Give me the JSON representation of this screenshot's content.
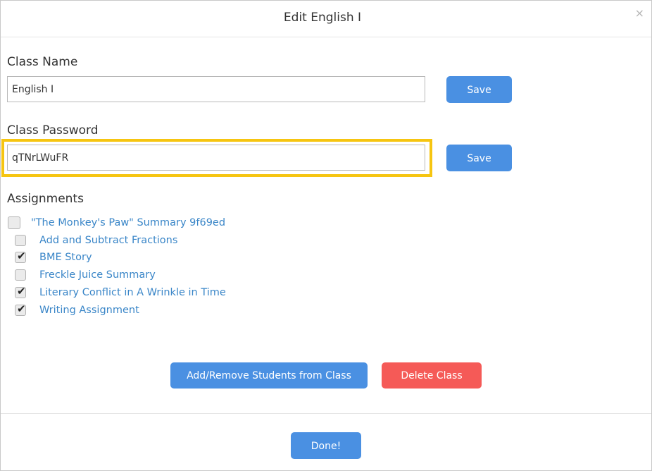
{
  "modal": {
    "title": "Edit English I",
    "close_glyph": "×"
  },
  "class_name": {
    "label": "Class Name",
    "value": "English I",
    "save_label": "Save"
  },
  "class_password": {
    "label": "Class Password",
    "value": "qTNrLWuFR",
    "save_label": "Save"
  },
  "assignments": {
    "label": "Assignments",
    "parent": {
      "label": "\"The Monkey's Paw\" Summary 9f69ed",
      "checked": false
    },
    "items": [
      {
        "label": "Add and Subtract Fractions",
        "checked": false
      },
      {
        "label": "BME Story",
        "checked": true
      },
      {
        "label": "Freckle Juice Summary",
        "checked": false
      },
      {
        "label": "Literary Conflict in A Wrinkle in Time",
        "checked": true
      },
      {
        "label": "Writing Assignment",
        "checked": true
      }
    ]
  },
  "actions": {
    "students_label": "Add/Remove Students from Class",
    "delete_label": "Delete Class",
    "done_label": "Done!"
  },
  "colors": {
    "primary_button": "#4a90e2",
    "danger_button": "#f55a57",
    "link": "#3a86c8",
    "highlight": "#f6c511"
  }
}
